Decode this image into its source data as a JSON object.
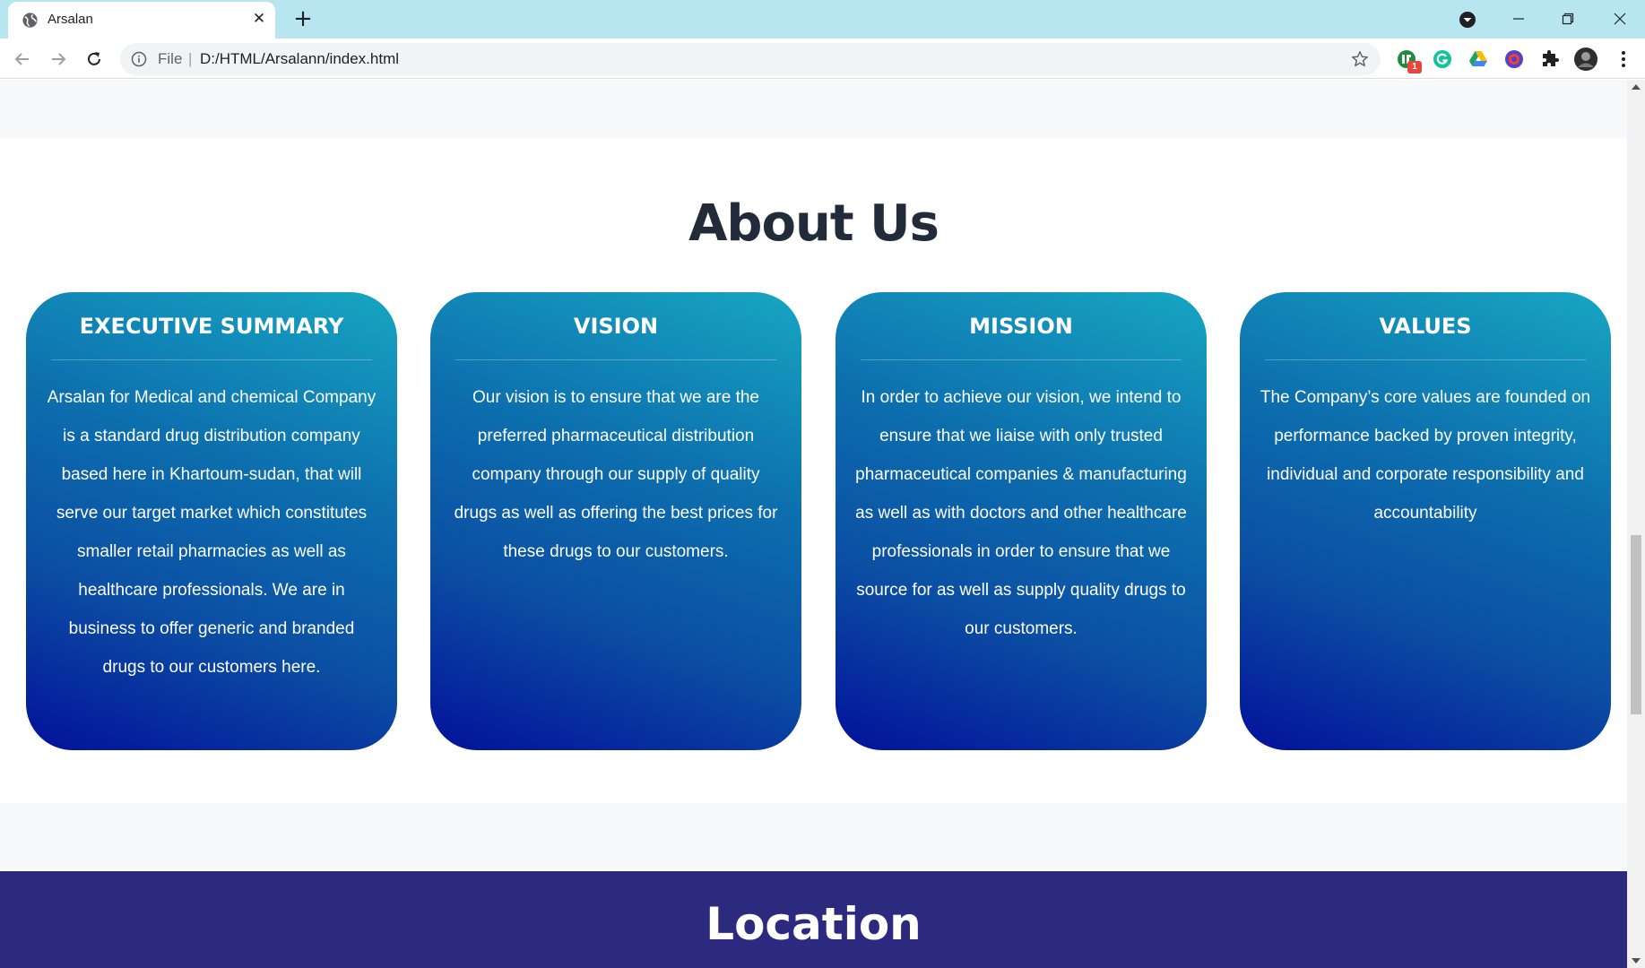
{
  "browser": {
    "tab_title": "Arsalan",
    "omnibox_scheme": "File",
    "omnibox_separator": "|",
    "url": "D:/HTML/Arsalann/index.html",
    "extension_badge": "1",
    "icons": [
      "globe-icon",
      "close-icon",
      "plus-icon",
      "profile-dropdown-icon",
      "minimize-icon",
      "restore-icon",
      "back-icon",
      "forward-icon",
      "reload-icon",
      "info-icon",
      "star-icon",
      "extension-icon",
      "puzzle-icon",
      "avatar",
      "kebab-menu-icon"
    ]
  },
  "about": {
    "title": "About Us",
    "cards": [
      {
        "title": "EXECUTIVE SUMMARY",
        "body": "Arsalan for Medical and chemical Company is a standard drug distribution company based here in Khartoum-sudan, that will serve our target market which constitutes smaller retail pharmacies as well as healthcare professionals. We are in business to offer generic and branded drugs to our customers here."
      },
      {
        "title": "VISION",
        "body": "Our vision is to ensure that we are the preferred pharmaceutical distribution company through our supply of quality drugs as well as offering the best prices for these drugs to our customers."
      },
      {
        "title": "MISSION",
        "body": "In order to achieve our vision, we intend to ensure that we liaise with only trusted pharmaceutical companies & manufacturing as well as with doctors and other healthcare professionals in order to ensure that we source for as well as supply quality drugs to our customers."
      },
      {
        "title": "VALUES",
        "body": "The Company’s core values are founded on performance backed by proven integrity, individual and corporate responsibility and accountability"
      }
    ]
  },
  "location": {
    "title": "Location"
  },
  "colors": {
    "tab_strip": "#b7e6f0",
    "card_gradient_top": "#17a6c2",
    "card_gradient_bottom": "#03119a",
    "location_bg": "#2b2a7e",
    "heading": "#222b3a"
  }
}
